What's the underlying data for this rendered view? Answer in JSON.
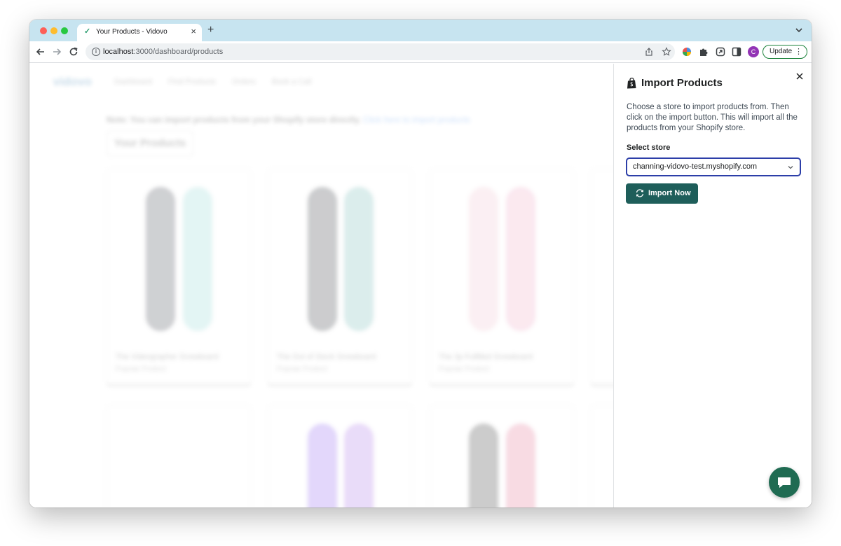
{
  "browser": {
    "tab_title": "Your Products - Vidovo",
    "tab_close": "×",
    "new_tab": "+",
    "url_host": "localhost",
    "url_path": ":3000/dashboard/products",
    "avatar_letter": "C",
    "update_label": "Update",
    "update_menu": "⋮"
  },
  "background": {
    "logo": "vidovo",
    "nav": [
      "Dashboard",
      "Find Products",
      "Orders",
      "Book a Call"
    ],
    "note": "Note: You can import products from your Shopify store directly.",
    "note_link": "Click here to import products",
    "your_products": "Your Products",
    "cards": [
      {
        "title": "The Videographer Snowboard",
        "subtitle": "Popular Product"
      },
      {
        "title": "The Out of Stock Snowboard",
        "subtitle": "Popular Product"
      },
      {
        "title": "The 3p Fulfilled Snowboard",
        "subtitle": "Popular Product"
      }
    ]
  },
  "panel": {
    "title": "Import Products",
    "description": "Choose a store to import products from. Then click on the import button. This will import all the products from your Shopify store.",
    "select_label": "Select store",
    "selected_store": "channing-vidovo-test.myshopify.com",
    "import_button": "Import Now"
  },
  "colors": {
    "tab_strip": "#c7e4f0",
    "primary_button": "#1e5e5a",
    "select_focus": "#2c3ea8",
    "chat_button": "#1f6b52"
  }
}
